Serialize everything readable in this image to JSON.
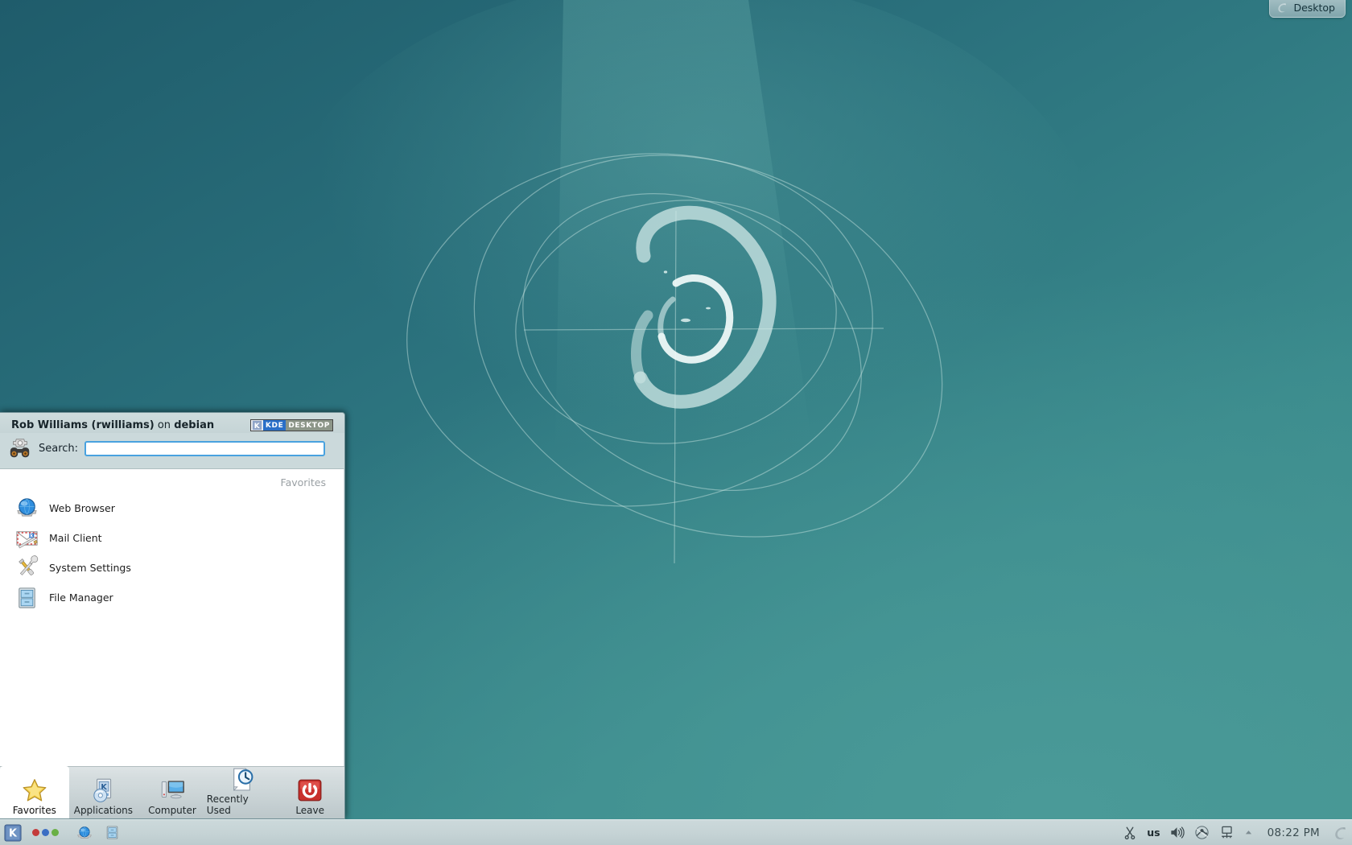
{
  "desktop": {
    "toolbox_label": "Desktop",
    "toolbox_icon": "cashew-icon",
    "wallpaper_name": "debian-swirl-wallpaper",
    "colors": {
      "wallpaper_dark": "#1f5c6b",
      "wallpaper_mid": "#2a707c",
      "wallpaper_light": "#4a9a98",
      "panel_bg": "#c9d5d7",
      "menu_bg": "#cbd9db",
      "accent_blue": "#49a2df"
    }
  },
  "kickoff": {
    "user_full_name": "Rob Williams",
    "user_login": "(rwilliams)",
    "on_word": " on ",
    "hostname": "debian",
    "badge": {
      "k_glyph": "K",
      "word1": "KDE",
      "word2": "DESKTOP"
    },
    "search": {
      "icon": "search-binoculars-icon",
      "label": "Search:",
      "value": "",
      "placeholder": ""
    },
    "favorites_caption": "Favorites",
    "favorites": [
      {
        "label": "Web Browser",
        "icon": "web-browser-icon"
      },
      {
        "label": "Mail Client",
        "icon": "mail-client-icon"
      },
      {
        "label": "System Settings",
        "icon": "system-settings-icon"
      },
      {
        "label": "File Manager",
        "icon": "file-manager-icon"
      }
    ],
    "tabs": [
      {
        "label": "Favorites",
        "icon": "star-icon",
        "selected": true
      },
      {
        "label": "Applications",
        "icon": "applications-icon",
        "selected": false
      },
      {
        "label": "Computer",
        "icon": "computer-icon",
        "selected": false
      },
      {
        "label": "Recently Used",
        "icon": "recent-clock-icon",
        "selected": false
      },
      {
        "label": "Leave",
        "icon": "leave-power-icon",
        "selected": false
      }
    ]
  },
  "panel": {
    "launcher": {
      "icon": "kde-k-launcher-icon",
      "label": "K"
    },
    "pager": {
      "dots": [
        "#c33b3b",
        "#3b6ec3",
        "#69b046"
      ]
    },
    "quick_launch": [
      {
        "icon": "web-browser-icon",
        "label": "Web Browser"
      },
      {
        "icon": "file-manager-icon",
        "label": "File Manager"
      }
    ],
    "tray": [
      {
        "icon": "klipper-scissors-icon",
        "label": "Klipper"
      },
      {
        "icon": "keyboard-layout-icon",
        "label": "us"
      },
      {
        "icon": "volume-speaker-icon",
        "label": "Volume"
      },
      {
        "icon": "device-notifier-icon",
        "label": "Device Notifier"
      },
      {
        "icon": "network-monitor-icon",
        "label": "Network"
      },
      {
        "icon": "tray-expand-icon",
        "label": "Show hidden icons"
      }
    ],
    "keyboard_layout": "us",
    "clock": "08:22 PM",
    "toolbox_icon": "cashew-icon"
  }
}
